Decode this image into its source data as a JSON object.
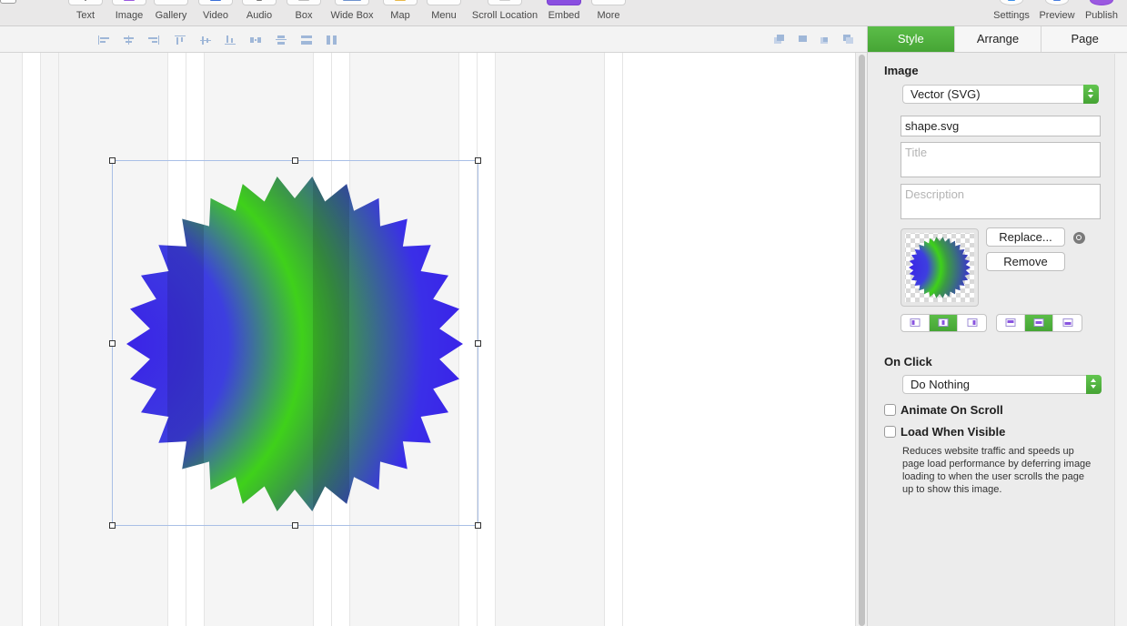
{
  "toolbar": {
    "items": [
      {
        "label": "Text",
        "icon": "text-icon"
      },
      {
        "label": "Image",
        "icon": "image-icon"
      },
      {
        "label": "Gallery",
        "icon": "gallery-icon"
      },
      {
        "label": "Video",
        "icon": "video-icon"
      },
      {
        "label": "Audio",
        "icon": "audio-icon"
      },
      {
        "label": "Box",
        "icon": "box-icon"
      },
      {
        "label": "Wide Box",
        "icon": "wide-box-icon"
      },
      {
        "label": "Map",
        "icon": "map-icon"
      },
      {
        "label": "Menu",
        "icon": "menu-icon"
      },
      {
        "label": "Scroll Location",
        "icon": "scroll-location-icon"
      },
      {
        "label": "Embed",
        "icon": "embed-icon"
      },
      {
        "label": "More",
        "icon": "more-icon"
      }
    ],
    "right_items": [
      {
        "label": "Settings",
        "icon": "settings-icon"
      },
      {
        "label": "Preview",
        "icon": "preview-icon"
      },
      {
        "label": "Publish",
        "icon": "publish-icon"
      }
    ]
  },
  "inspector": {
    "tabs": [
      "Style",
      "Arrange",
      "Page"
    ],
    "active_tab": "Style",
    "image_section": {
      "title": "Image",
      "type_select": "Vector (SVG)",
      "filename": "shape.svg",
      "title_placeholder": "Title",
      "description_placeholder": "Description",
      "replace_label": "Replace...",
      "remove_label": "Remove"
    },
    "on_click": {
      "title": "On Click",
      "action": "Do Nothing"
    },
    "animate_on_scroll": {
      "label": "Animate On Scroll",
      "checked": false
    },
    "load_when_visible": {
      "label": "Load When Visible",
      "checked": false,
      "description": "Reduces website traffic and speeds up page load performance by deferring image loading to when the user scrolls the page up to show this image."
    }
  },
  "colors": {
    "accent": "#4caf3c",
    "shape_blue": "#3a1fe8",
    "shape_green": "#3fd11a",
    "selection": "#a9bfe6"
  }
}
